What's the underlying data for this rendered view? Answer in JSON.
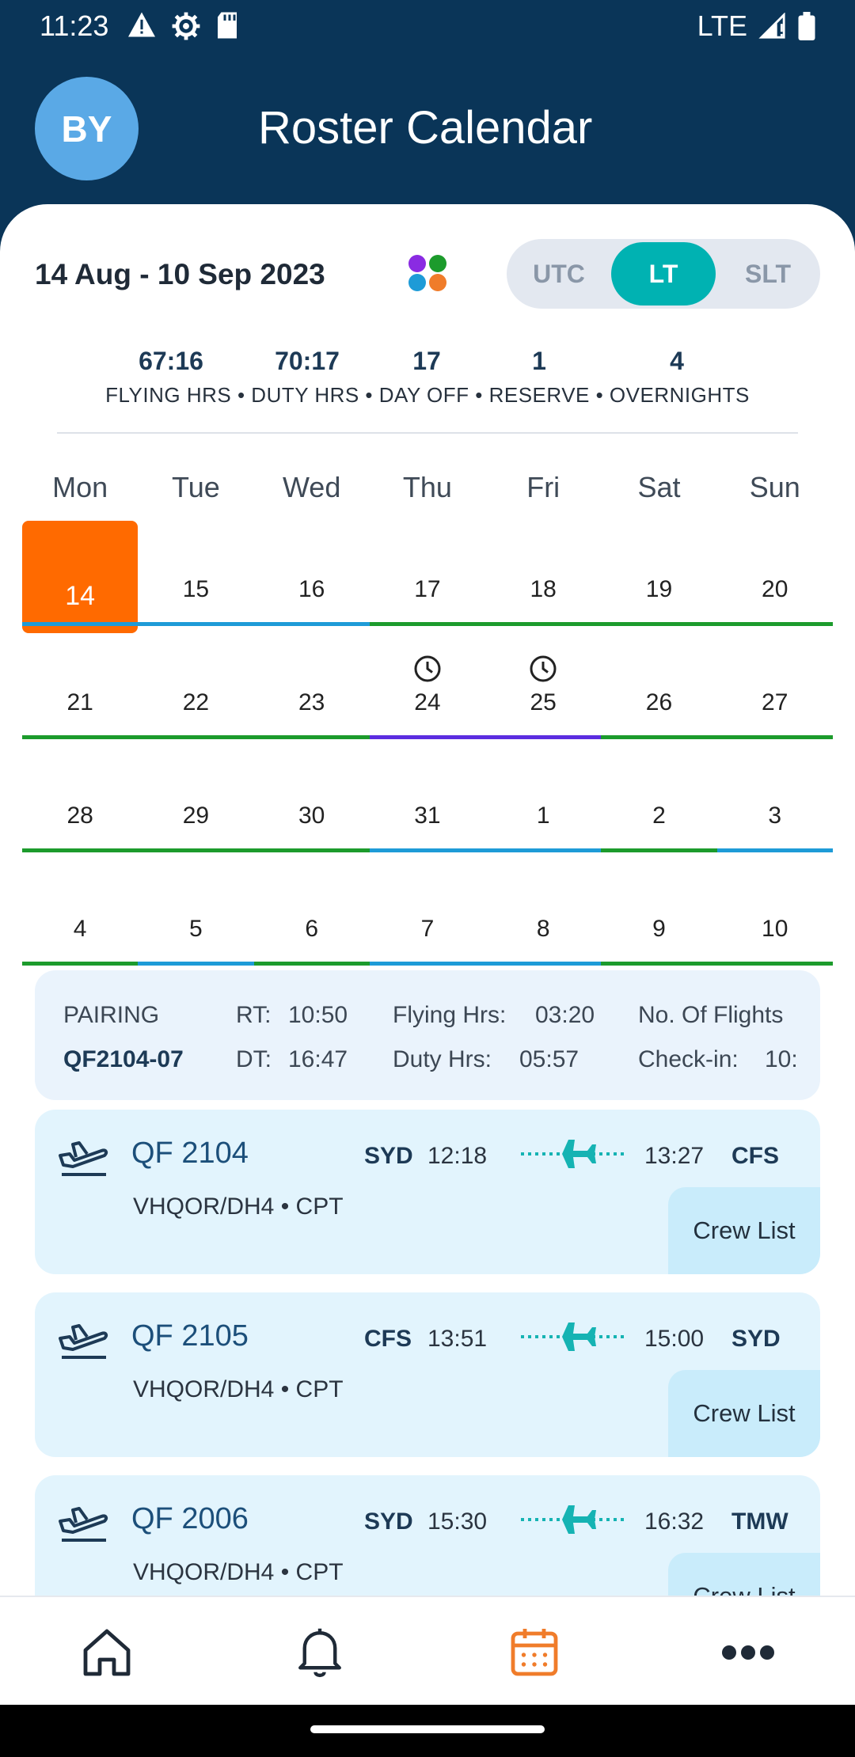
{
  "status_bar": {
    "time": "11:23",
    "network": "LTE"
  },
  "header": {
    "avatar_initials": "BY",
    "title": "Roster Calendar"
  },
  "range": {
    "label": "14 Aug - 10 Sep 2023"
  },
  "timezone": {
    "options": [
      "UTC",
      "LT",
      "SLT"
    ],
    "selected": "LT"
  },
  "stats": {
    "values": [
      "67:16",
      "70:17",
      "17",
      "1",
      "4"
    ],
    "labels_line": "FLYING HRS • DUTY HRS • DAY OFF • RESERVE • OVERNIGHTS"
  },
  "calendar": {
    "weekdays": [
      "Mon",
      "Tue",
      "Wed",
      "Thu",
      "Fri",
      "Sat",
      "Sun"
    ],
    "selected_day": "14",
    "weeks": [
      [
        "14",
        "15",
        "16",
        "17",
        "18",
        "19",
        "20"
      ],
      [
        "21",
        "22",
        "23",
        "24",
        "25",
        "26",
        "27"
      ],
      [
        "28",
        "29",
        "30",
        "31",
        "1",
        "2",
        "3"
      ],
      [
        "4",
        "5",
        "6",
        "7",
        "8",
        "9",
        "10"
      ]
    ],
    "clock_days": [
      "24",
      "25"
    ],
    "colors": {
      "flight": "#1e9bd7",
      "off": "#1c9b2c",
      "reserve": "#5b2de0",
      "today": "#ff6a00"
    }
  },
  "pairing": {
    "label": "PAIRING",
    "code": "QF2104-07",
    "rt_label": "RT:",
    "rt_value": "10:50",
    "dt_label": "DT:",
    "dt_value": "16:47",
    "flying_label": "Flying Hrs:",
    "flying_value": "03:20",
    "duty_label": "Duty Hrs:",
    "duty_value": "05:57",
    "flights_label": "No. Of Flights",
    "checkin_label": "Check-in:",
    "checkin_value": "10:"
  },
  "flights": [
    {
      "number": "QF 2104",
      "from": "SYD",
      "dep": "12:18",
      "arr": "13:27",
      "to": "CFS",
      "aircraft": "VHQOR/DH4 • CPT",
      "crew_button": "Crew List"
    },
    {
      "number": "QF 2105",
      "from": "CFS",
      "dep": "13:51",
      "arr": "15:00",
      "to": "SYD",
      "aircraft": "VHQOR/DH4 • CPT",
      "crew_button": "Crew List"
    },
    {
      "number": "QF 2006",
      "from": "SYD",
      "dep": "15:30",
      "arr": "16:32",
      "to": "TMW",
      "aircraft": "VHQOR/DH4 • CPT",
      "crew_button": "Crew List"
    }
  ],
  "bottom_nav": {
    "items": [
      {
        "icon": "home-icon"
      },
      {
        "icon": "bell-icon"
      },
      {
        "icon": "calendar-icon",
        "active": true
      },
      {
        "icon": "more-icon"
      }
    ],
    "active_color": "#f07c2a"
  }
}
